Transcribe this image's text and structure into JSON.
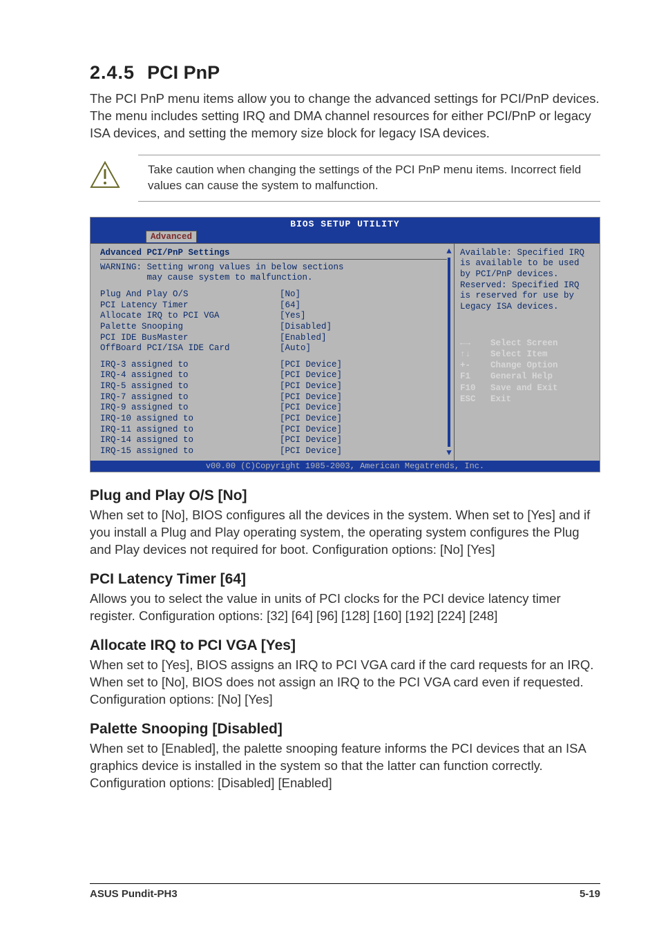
{
  "heading": {
    "num": "2.4.5",
    "title": "PCI PnP"
  },
  "intro": "The PCI PnP menu items allow you to change the advanced settings for PCI/PnP devices. The menu includes setting IRQ and DMA channel resources for either PCI/PnP or legacy ISA devices, and setting the memory size block for legacy ISA devices.",
  "caution": "Take caution when changing the settings of the PCI PnP menu items. Incorrect field values can cause the system to malfunction.",
  "bios": {
    "title": "BIOS SETUP UTILITY",
    "tab": "Advanced",
    "section_title": "Advanced PCI/PnP Settings",
    "warning_l1": "WARNING: Setting wrong values in below sections",
    "warning_l2": "         may cause system to malfunction.",
    "rows1": [
      {
        "k": "Plug And Play O/S",
        "v": "[No]"
      },
      {
        "k": "PCI Latency Timer",
        "v": "[64]"
      },
      {
        "k": "Allocate IRQ to PCI VGA",
        "v": "[Yes]"
      },
      {
        "k": "Palette Snooping",
        "v": "[Disabled]"
      },
      {
        "k": "PCI IDE BusMaster",
        "v": "[Enabled]"
      },
      {
        "k": "OffBoard PCI/ISA IDE Card",
        "v": "[Auto]"
      }
    ],
    "rows2": [
      {
        "k": "IRQ-3 assigned to",
        "v": "[PCI Device]"
      },
      {
        "k": "IRQ-4 assigned to",
        "v": "[PCI Device]"
      },
      {
        "k": "IRQ-5 assigned to",
        "v": "[PCI Device]"
      },
      {
        "k": "IRQ-7 assigned to",
        "v": "[PCI Device]"
      },
      {
        "k": "IRQ-9 assigned to",
        "v": "[PCI Device]"
      },
      {
        "k": "IRQ-10 assigned to",
        "v": "[PCI Device]"
      },
      {
        "k": "IRQ-11 assigned to",
        "v": "[PCI Device]"
      },
      {
        "k": "IRQ-14 assigned to",
        "v": "[PCI Device]"
      },
      {
        "k": "IRQ-15 assigned to",
        "v": "[PCI Device]"
      }
    ],
    "help": "Available: Specified IRQ is available to be used by PCI/PnP devices.\nReserved: Specified IRQ is reserved for use by Legacy ISA devices.",
    "keys": [
      {
        "kk": "←→",
        "kl": "Select Screen"
      },
      {
        "kk": "↑↓",
        "kl": "Select Item"
      },
      {
        "kk": "+-",
        "kl": "Change Option"
      },
      {
        "kk": "F1",
        "kl": "General Help"
      },
      {
        "kk": "F10",
        "kl": "Save and Exit"
      },
      {
        "kk": "ESC",
        "kl": "Exit"
      }
    ],
    "footer": "v00.00 (C)Copyright 1985-2003, American Megatrends, Inc."
  },
  "sections": [
    {
      "title": "Plug and Play O/S [No]",
      "body": "When set to [No], BIOS configures all the devices in the system. When set to [Yes] and if you install a Plug and Play operating system, the operating system configures the Plug and Play devices not required for boot. Configuration options: [No] [Yes]"
    },
    {
      "title": "PCI Latency Timer [64]",
      "body": "Allows you to select the value in units of PCI clocks for the PCI device latency timer register. Configuration options: [32] [64] [96] [128] [160] [192] [224] [248]"
    },
    {
      "title": "Allocate IRQ to PCI VGA [Yes]",
      "body": "When set to [Yes], BIOS assigns an IRQ to PCI VGA card if the card requests for an IRQ. When set to [No], BIOS does not assign an IRQ to the PCI VGA card even if requested. Configuration options: [No] [Yes]"
    },
    {
      "title": "Palette Snooping [Disabled]",
      "body": "When set to [Enabled], the palette snooping feature informs the PCI devices that an ISA graphics device is installed in the system so that the latter can function correctly. Configuration options: [Disabled] [Enabled]"
    }
  ],
  "footer": {
    "left": "ASUS Pundit-PH3",
    "right": "5-19"
  }
}
